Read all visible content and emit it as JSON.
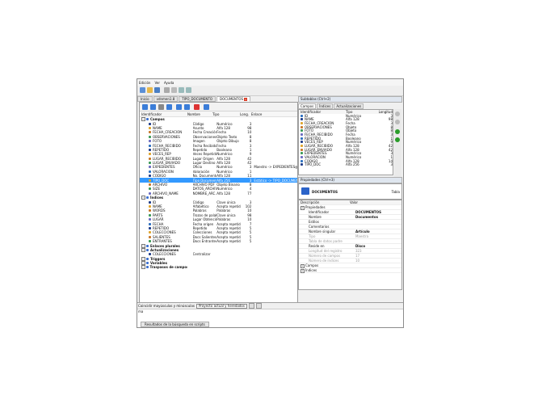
{
  "menu": [
    "Edición",
    "Ver",
    "Ayuda"
  ],
  "tabs": [
    {
      "label": "Inicio",
      "active": false
    },
    {
      "label": "vdnmen1.8",
      "active": false
    },
    {
      "label": "TIPO_DOCUMENTO",
      "active": false
    },
    {
      "label": "DOCUMENTOS",
      "active": true
    }
  ],
  "fields_header": {
    "identifier": "Identificador",
    "name": "Nombre",
    "type": "Tipo",
    "length": "Long.",
    "link": "Enlace"
  },
  "fields": [
    {
      "kind": "group",
      "identifier": "Campos"
    },
    {
      "identifier": "ID",
      "name": "Código",
      "type": "Numérico",
      "length": "3",
      "link": ""
    },
    {
      "identifier": "NAME",
      "name": "Asunto",
      "type": "Alfa 128",
      "length": "98",
      "link": ""
    },
    {
      "identifier": "FECHA_CREACION",
      "name": "Fecha Creación",
      "type": "Fecha",
      "length": "10",
      "link": ""
    },
    {
      "identifier": "OBSERVACIONES",
      "name": "Observaciones",
      "type": "Objeto Texto",
      "length": "8",
      "link": ""
    },
    {
      "identifier": "FOTO",
      "name": "Imagen",
      "type": "Objeto Dibujo",
      "length": "8",
      "link": ""
    },
    {
      "identifier": "FECHA_RECIBIDO",
      "name": "Fecha Recibido",
      "type": "Fecha",
      "length": "3",
      "link": ""
    },
    {
      "identifier": "REPETIDO",
      "name": "Repetido",
      "type": "Booleano",
      "length": "1",
      "link": ""
    },
    {
      "identifier": "VECES_REP",
      "name": "Veces Repetido",
      "type": "Numérico",
      "length": "9",
      "link": ""
    },
    {
      "identifier": "LUGAR_RECIBIDO",
      "name": "Lugar Origen",
      "type": "Alfa 128",
      "length": "42",
      "link": ""
    },
    {
      "identifier": "LUGAR_ENVIADO",
      "name": "Lugar Destino",
      "type": "Alfa 128",
      "length": "42",
      "link": ""
    },
    {
      "identifier": "EXPEDIENTES",
      "name": "Oficio",
      "type": "Numérico",
      "length": "3",
      "link": "Maestro -> EXPEDIENTES@vdoc..."
    },
    {
      "identifier": "VALORACION",
      "name": "Valoración",
      "type": "Numérico",
      "length": "1",
      "link": ""
    },
    {
      "identifier": "CODIGO",
      "name": "No. Documento",
      "type": "Alfa 128",
      "length": "11",
      "link": ""
    },
    {
      "identifier": "TIPO_DOC",
      "name": "Tipo Documento",
      "type": "Alfa 256",
      "length": "3",
      "link": "Estático -> TIPO_DOCUMENTO...",
      "selected": true
    },
    {
      "identifier": "ARCHIVO",
      "name": "ARCHIVO PDF",
      "type": "Objeto Binario",
      "length": "8",
      "link": ""
    },
    {
      "identifier": "SIZE",
      "name": "DATOS_ARCHIVO",
      "type": "Numérico",
      "length": "4",
      "link": ""
    },
    {
      "identifier": "ARCHIVO_NAME",
      "name": "NOMBRE_ARC...",
      "type": "Alfa 128",
      "length": "77",
      "link": ""
    },
    {
      "kind": "group",
      "identifier": "Índices"
    },
    {
      "identifier": "ID",
      "name": "Código",
      "type": "Clave única",
      "length": "3",
      "link": ""
    },
    {
      "identifier": "NAME",
      "name": "Alfabético",
      "type": "Acepta repetidas",
      "length": "102",
      "link": ""
    },
    {
      "identifier": "WORDS",
      "name": "Palabras",
      "type": "Palabras",
      "length": "10",
      "link": ""
    },
    {
      "identifier": "PARTS",
      "name": "Trozos de palab...",
      "type": "Clave única",
      "length": "98",
      "link": ""
    },
    {
      "identifier": "LUGAR",
      "name": "Lugar Obtención",
      "type": "Palabras",
      "length": "10",
      "link": ""
    },
    {
      "identifier": "FECHA",
      "name": "Fecha origen",
      "type": "Acepta repetidas",
      "length": "7",
      "link": ""
    },
    {
      "identifier": "REPETIDO",
      "name": "Repetido",
      "type": "Acepta repetidas",
      "length": "5",
      "link": ""
    },
    {
      "identifier": "COLECCIONES",
      "name": "Colecciones",
      "type": "Acepta repetidas",
      "length": "5",
      "link": ""
    },
    {
      "identifier": "SALIENTES",
      "name": "Docs Salientes",
      "type": "Acepta repetidas",
      "length": "5",
      "link": ""
    },
    {
      "identifier": "ENTRANTES",
      "name": "Docs Entrantes",
      "type": "Acepta repetidas",
      "length": "5",
      "link": ""
    },
    {
      "kind": "group",
      "identifier": "Enlaces plurales"
    },
    {
      "kind": "group",
      "identifier": "Actualizaciones"
    },
    {
      "identifier": "COLECCIONES",
      "name": "Centralizar",
      "type": "",
      "length": "",
      "link": ""
    },
    {
      "kind": "group",
      "identifier": "Triggers"
    },
    {
      "kind": "group",
      "identifier": "Variables"
    },
    {
      "kind": "group",
      "identifier": "Traspasos de campos"
    }
  ],
  "subtables": {
    "title": "Subtablas (Ctrl+2)",
    "tabs": [
      "Campos",
      "Índices",
      "Actualizaciones"
    ],
    "header": {
      "identifier": "Identificador",
      "type": "Tipo",
      "length": "Longitud"
    },
    "rows": [
      {
        "identifier": "ID",
        "type": "Numérico",
        "length": "3"
      },
      {
        "identifier": "NAME",
        "type": "Alfa 128",
        "length": "98"
      },
      {
        "identifier": "FECHA_CREACION",
        "type": "Fecha",
        "length": "3"
      },
      {
        "identifier": "OBSERVACIONES",
        "type": "Objeto",
        "length": "8"
      },
      {
        "identifier": "FOTO",
        "type": "Objeto",
        "length": "8"
      },
      {
        "identifier": "FECHA_RECIBIDO",
        "type": "Fecha",
        "length": "3"
      },
      {
        "identifier": "REPETIDO",
        "type": "Booleano",
        "length": "1"
      },
      {
        "identifier": "VECES_REP",
        "type": "Numérico",
        "length": "9"
      },
      {
        "identifier": "LUGAR_RECIBIDO",
        "type": "Alfa 128",
        "length": "42"
      },
      {
        "identifier": "LUGAR_ENVIADO",
        "type": "Alfa 128",
        "length": "42"
      },
      {
        "identifier": "EXPEDIENTES",
        "type": "Numérico",
        "length": "3"
      },
      {
        "identifier": "VALORACION",
        "type": "Numérico",
        "length": "1"
      },
      {
        "identifier": "CODIGO",
        "type": "Alfa 128",
        "length": "14"
      },
      {
        "identifier": "TIPO_DOC",
        "type": "Alfa 256",
        "length": "3"
      }
    ]
  },
  "properties": {
    "title": "Propiedades (Ctrl+3)",
    "object_name": "DOCUMENTOS",
    "object_kind": "Tabla",
    "header": {
      "description": "Descripción",
      "value": "Valor"
    },
    "rows": [
      {
        "kind": "section",
        "description": "Propiedades",
        "value": ""
      },
      {
        "description": "Identificador",
        "value": "DOCUMENTOS"
      },
      {
        "description": "Nombre",
        "value": "Documentos"
      },
      {
        "description": "Estilos",
        "value": ""
      },
      {
        "description": "Comentarios",
        "value": ""
      },
      {
        "description": "Nombre singular",
        "value": "Artículo"
      },
      {
        "description": "Tipo",
        "value": "Maestra",
        "disabled": true
      },
      {
        "description": "Tabla de datos padre",
        "value": "",
        "disabled": true
      },
      {
        "description": "Reside en",
        "value": "Disco"
      },
      {
        "description": "Longitud del registro",
        "value": "323",
        "disabled": true
      },
      {
        "description": "Número de campos",
        "value": "17",
        "disabled": true
      },
      {
        "description": "Número de índices",
        "value": "10",
        "disabled": true
      },
      {
        "kind": "section",
        "description": "Campos",
        "value": ""
      },
      {
        "kind": "section",
        "description": "Índices",
        "value": ""
      }
    ]
  },
  "search": {
    "label": "Coincidir mayúsculas y minúsculas",
    "scope": "Proyecto actual y heredados",
    "input_value": "ma"
  },
  "bottom_tab": "Resultados de la búsqueda en scripts"
}
